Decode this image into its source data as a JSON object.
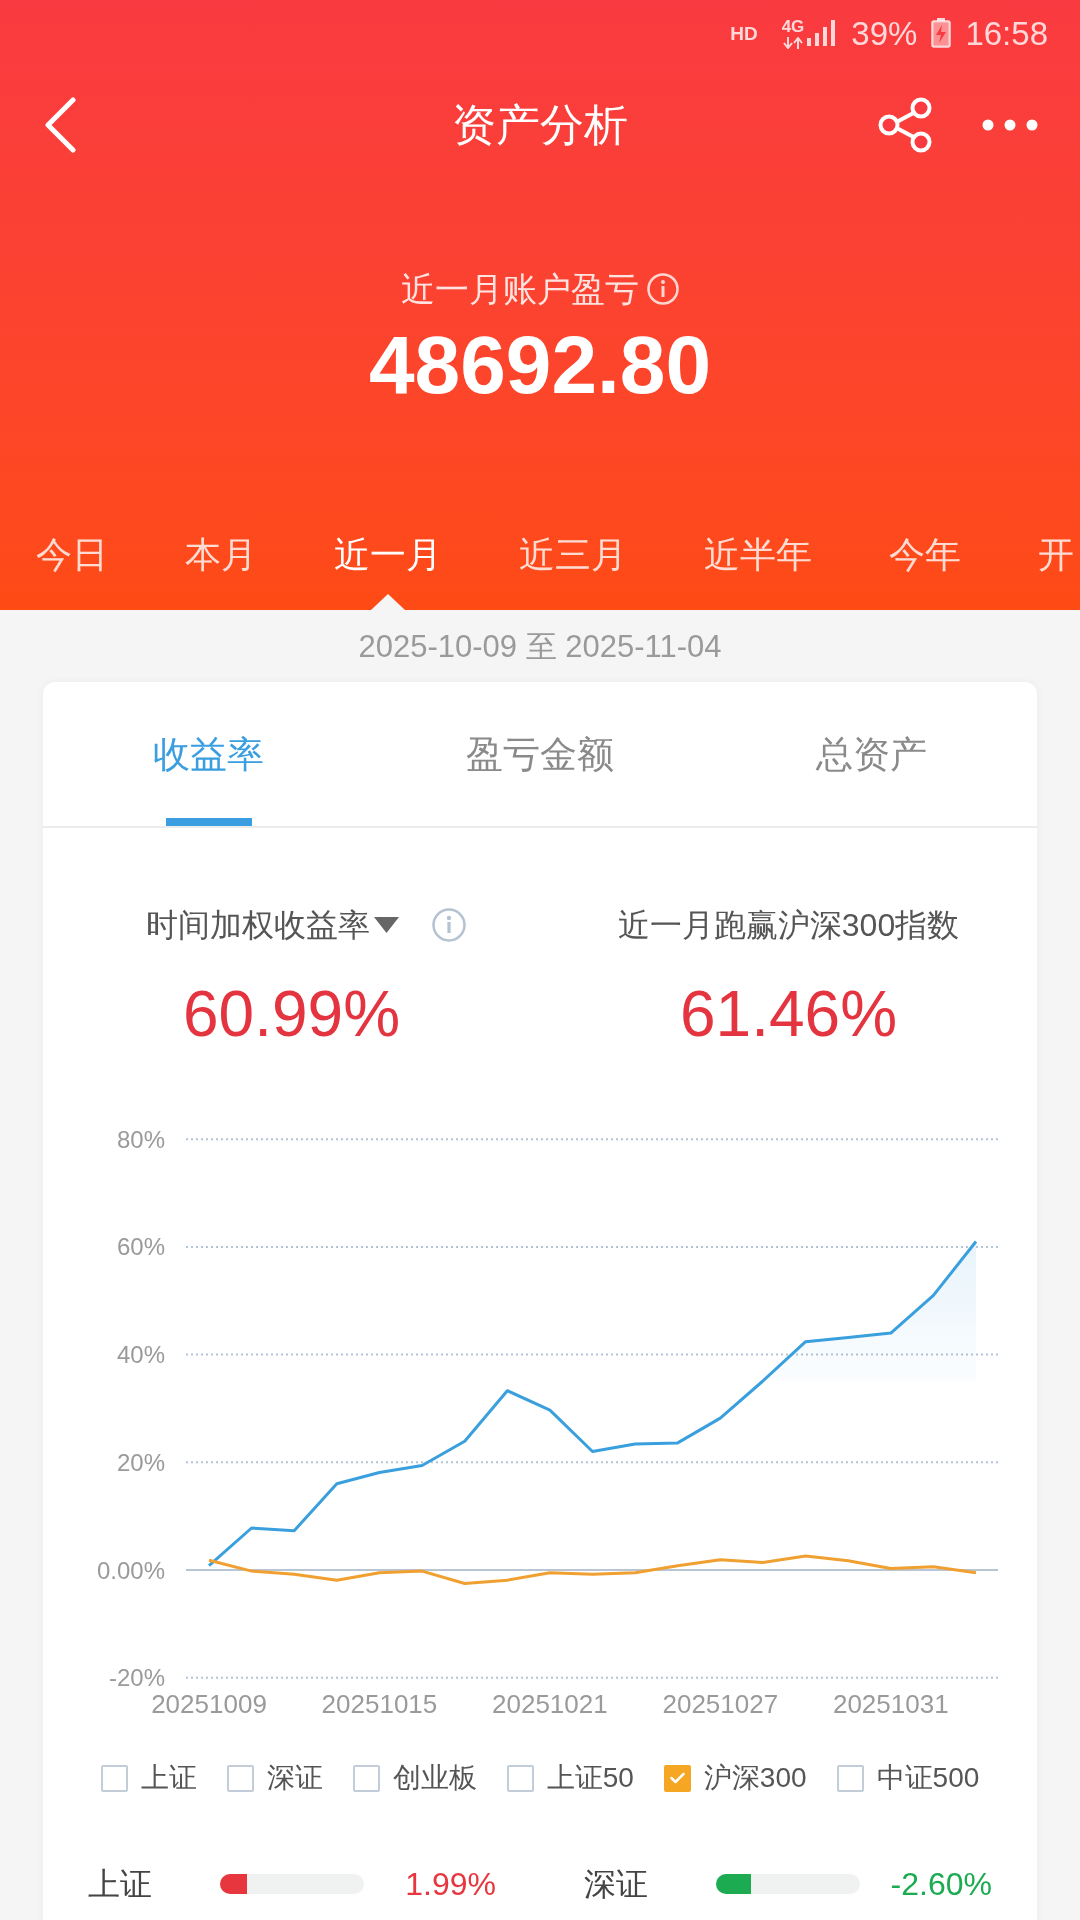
{
  "status_bar": {
    "hd": "HD",
    "network": "4G",
    "battery": "39%",
    "time": "16:58"
  },
  "header": {
    "title": "资产分析"
  },
  "summary": {
    "label": "近一月账户盈亏",
    "value": "48692.80"
  },
  "periods": [
    {
      "label": "今日",
      "selected": false
    },
    {
      "label": "本月",
      "selected": false
    },
    {
      "label": "近一月",
      "selected": true
    },
    {
      "label": "近三月",
      "selected": false
    },
    {
      "label": "近半年",
      "selected": false
    },
    {
      "label": "今年",
      "selected": false
    },
    {
      "label": "开",
      "selected": false
    }
  ],
  "date_range": "2025-10-09 至 2025-11-04",
  "card": {
    "tabs": [
      {
        "label": "收益率",
        "selected": true
      },
      {
        "label": "盈亏金额",
        "selected": false
      },
      {
        "label": "总资产",
        "selected": false
      }
    ],
    "metrics": [
      {
        "label": "时间加权收益率",
        "dropdown": true,
        "info": true,
        "value": "60.99%"
      },
      {
        "label": "近一月跑赢沪深300指数",
        "dropdown": false,
        "info": false,
        "value": "61.46%"
      }
    ],
    "chart_data": {
      "type": "line",
      "categories": [
        "20251009",
        null,
        null,
        null,
        "20251015",
        null,
        null,
        null,
        "20251021",
        null,
        null,
        null,
        "20251027",
        null,
        null,
        null,
        "20251031",
        null,
        null
      ],
      "ylim": [
        -20,
        80
      ],
      "yticks": [
        {
          "value": 80,
          "label": "80%"
        },
        {
          "value": 60,
          "label": "60%"
        },
        {
          "value": 40,
          "label": "40%"
        },
        {
          "value": 20,
          "label": "20%"
        },
        {
          "value": 0,
          "label": "0.00%"
        },
        {
          "value": -20,
          "label": "-20%"
        }
      ],
      "grid": true,
      "series": [
        {
          "color": "#3a9fdd",
          "values": [
            0.8,
            7.8,
            7.3,
            16.0,
            18.1,
            19.4,
            23.9,
            33.3,
            29.7,
            22.0,
            23.4,
            23.6,
            28.2,
            35.1,
            42.4,
            43.2,
            44.0,
            51.0,
            61.0
          ]
        },
        {
          "color": "#f0a030",
          "values": [
            1.8,
            -0.2,
            -0.8,
            -1.9,
            -0.5,
            -0.2,
            -2.5,
            -1.9,
            -0.5,
            -0.8,
            -0.5,
            0.8,
            1.9,
            1.4,
            2.6,
            1.7,
            0.3,
            0.6,
            -0.5
          ]
        }
      ]
    },
    "benchmarks": [
      {
        "label": "上证",
        "checked": false
      },
      {
        "label": "深证",
        "checked": false
      },
      {
        "label": "创业板",
        "checked": false
      },
      {
        "label": "上证50",
        "checked": false
      },
      {
        "label": "沪深300",
        "checked": true
      },
      {
        "label": "中证500",
        "checked": false
      }
    ],
    "indices": [
      {
        "name": "上证",
        "level": 0.19,
        "value": "1.99%",
        "color": "#e8363f"
      },
      {
        "name": "深证",
        "level": 0.24,
        "value": "-2.60%",
        "color": "#1dab52"
      }
    ]
  }
}
